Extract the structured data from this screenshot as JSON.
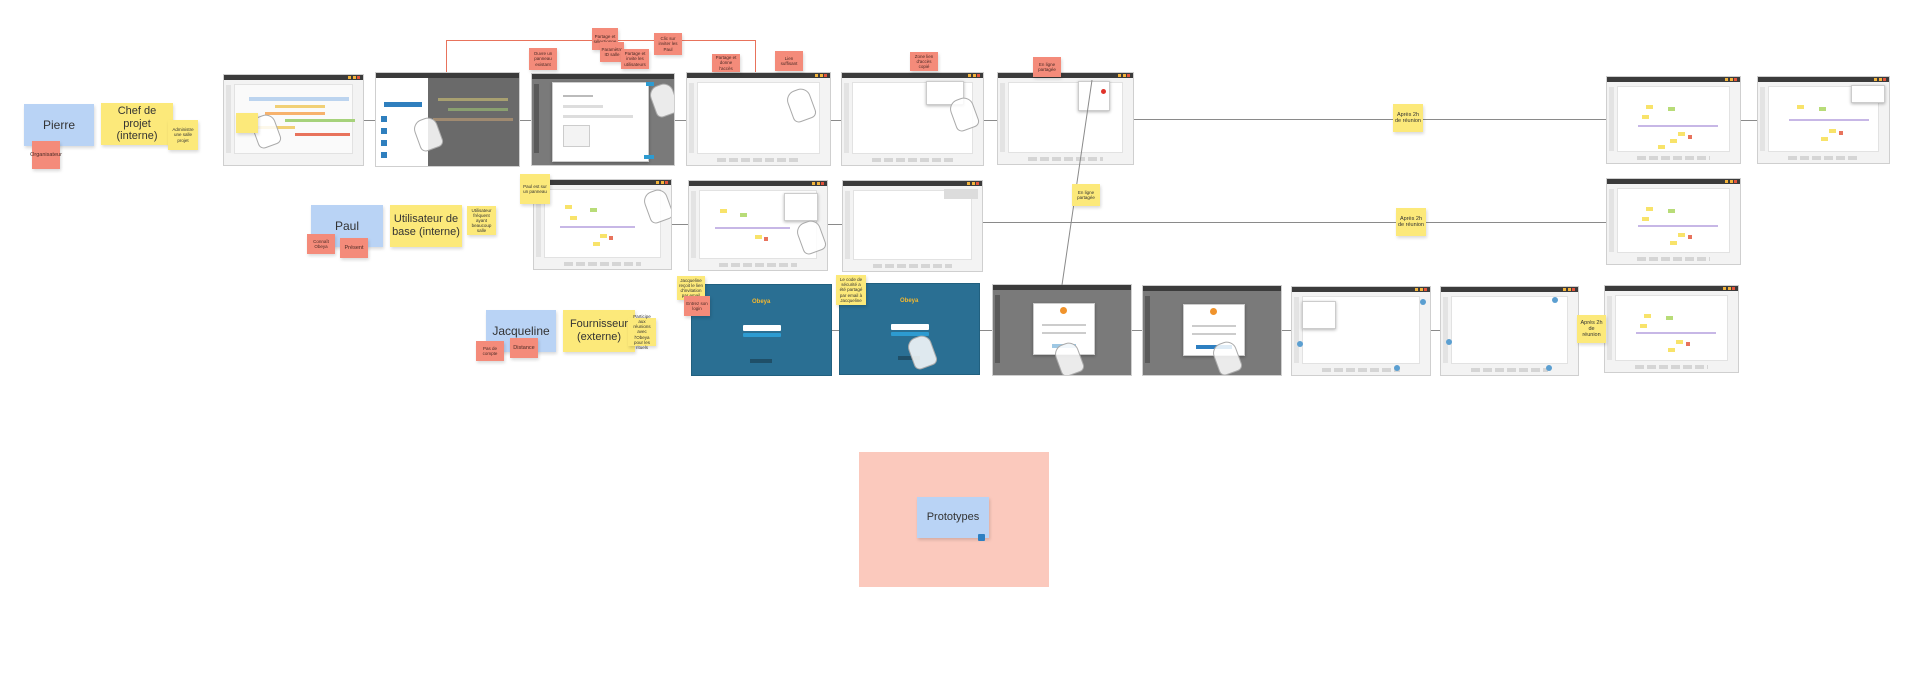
{
  "personas": {
    "pierre": {
      "name": "Pierre",
      "role": "Chef de projet (interne)",
      "tag_red": "Organisateur",
      "note": "Administre une salle projet"
    },
    "paul": {
      "name": "Paul",
      "role": "Utilisateur de base (interne)",
      "tag_red_1": "Connaît Obeya",
      "tag_red_2": "Présent",
      "note": "Utilisateur fréquent ayant beaucoup salle"
    },
    "jacqueline": {
      "name": "Jacqueline",
      "role": "Fournisseur (externe)",
      "tag_red_1": "Pas de compte",
      "tag_red_2": "Distance",
      "note": "Participe aux réunions avec l'Obeya pour les rituels"
    }
  },
  "flow_notes": {
    "row1_a": "Ouvre un panneau existant",
    "row1_b": "Partage et sélectionne",
    "row1_c": "Paramètre ID salle",
    "row1_d": "Partage et invite les utilisateurs",
    "row1_e": "Clic sur inviter les Paul",
    "row1_f": "Partage et donne l'accès",
    "row1_g": "Lien suffisant",
    "row1_h": "Zone lien d'accès copié",
    "row2_a": "Paul est sur un panneau",
    "row3_a": "Jacqueline reçoit le lien d'invitation par email",
    "row3_b": "Entrez son login",
    "row3_c": "Le code de sécurité a été partagé par email à Jacqueline",
    "mid": "En ligne partagée"
  },
  "after_meeting": {
    "row1": "Après 2h de réunion",
    "row2": "Après 2h de réunion",
    "row3": "Après 2h de réunion"
  },
  "prototypes": {
    "label": "Prototypes"
  },
  "colors": {
    "persona": "#b9d3f5",
    "sticky_yellow": "#fce97a",
    "sticky_red": "#f48b7a",
    "prototype_bg": "#fbc9bd",
    "login_blue": "#2a6f93"
  }
}
